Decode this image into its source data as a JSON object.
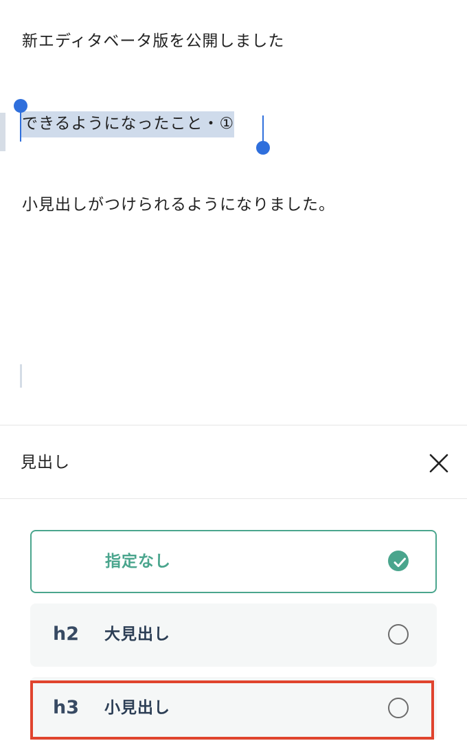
{
  "editor": {
    "title_line": "新エディタベータ版を公開しました",
    "heading_line": "できるようになったこと・①",
    "body_line": "小見出しがつけられるようになりました。"
  },
  "sheet": {
    "title": "見出し",
    "close_icon": "close-icon",
    "options": [
      {
        "tag": "",
        "label": "指定なし",
        "selected": true
      },
      {
        "tag": "h2",
        "label": "大見出し",
        "selected": false
      },
      {
        "tag": "h3",
        "label": "小見出し",
        "selected": false
      }
    ]
  },
  "colors": {
    "accent_green": "#4aa58d",
    "selection_blue": "#2f6fdc",
    "selection_bg": "#cfdbeb",
    "highlight_red": "#e0442e",
    "option_text": "#2c3e55"
  }
}
